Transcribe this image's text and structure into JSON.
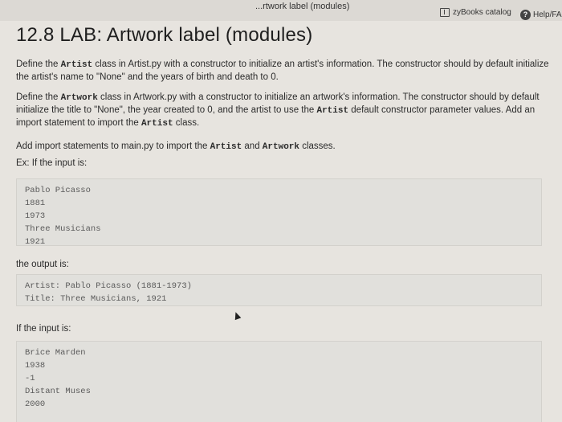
{
  "header": {
    "crumb": "...rtwork label (modules)",
    "catalog": "zyBooks catalog",
    "help": "Help/FAQ"
  },
  "title": "12.8 LAB: Artwork label (modules)",
  "para1": {
    "a": "Define the ",
    "code1": "Artist",
    "b": " class in Artist.py with a constructor to initialize an artist's information. The constructor should by default initialize the artist's name to \"None\" and the years of birth and death to 0."
  },
  "para2": {
    "a": "Define the ",
    "code1": "Artwork",
    "b": " class in Artwork.py with a constructor to initialize an artwork's information. The constructor should by default initialize the title to \"None\", the year created to 0, and the artist to use the ",
    "code2": "Artist",
    "c": " default constructor parameter values. Add an import statement to import the ",
    "code3": "Artist",
    "d": " class."
  },
  "para3": {
    "a": "Add import statements to main.py to import the ",
    "code1": "Artist",
    "b": " and ",
    "code2": "Artwork",
    "c": " classes."
  },
  "ex_label": "Ex: If the input is:",
  "input1": [
    "Pablo Picasso",
    "1881",
    "1973",
    "Three Musicians",
    "1921"
  ],
  "output_label": "the output is:",
  "output1": [
    "Artist: Pablo Picasso (1881-1973)",
    "Title: Three Musicians, 1921"
  ],
  "input2_label": "If the input is:",
  "input2": [
    "Brice Marden",
    "1938",
    "-1",
    "Distant Muses",
    "2000"
  ]
}
